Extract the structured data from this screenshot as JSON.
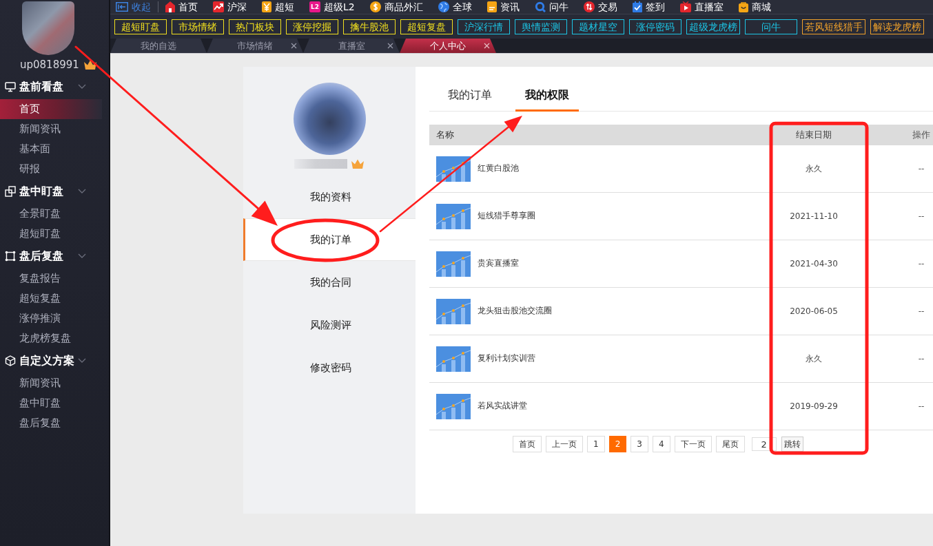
{
  "sidebar": {
    "user": {
      "name": "up0818991"
    },
    "sections": [
      {
        "title": "盘前看盘",
        "expanded": true,
        "items": [
          {
            "label": "首页",
            "selected": true
          },
          {
            "label": "新闻资讯",
            "selected": false
          },
          {
            "label": "基本面",
            "selected": false
          },
          {
            "label": "研报",
            "selected": false
          }
        ]
      },
      {
        "title": "盘中盯盘",
        "expanded": true,
        "items": [
          {
            "label": "全景盯盘",
            "selected": false
          },
          {
            "label": "超短盯盘",
            "selected": false
          }
        ]
      },
      {
        "title": "盘后复盘",
        "expanded": true,
        "items": [
          {
            "label": "复盘报告",
            "selected": false
          },
          {
            "label": "超短复盘",
            "selected": false
          },
          {
            "label": "涨停推演",
            "selected": false
          },
          {
            "label": "龙虎榜复盘",
            "selected": false
          }
        ]
      },
      {
        "title": "自定义方案",
        "expanded": true,
        "items": [
          {
            "label": "新闻资讯",
            "selected": false
          },
          {
            "label": "盘中盯盘",
            "selected": false
          },
          {
            "label": "盘后复盘",
            "selected": false
          }
        ]
      }
    ]
  },
  "toolbar": {
    "collapse": "收起",
    "items": [
      {
        "label": "首页"
      },
      {
        "label": "沪深"
      },
      {
        "label": "超短"
      },
      {
        "label": "超级L2",
        "icon_text": "L2"
      },
      {
        "label": "商品外汇"
      },
      {
        "label": "全球"
      },
      {
        "label": "资讯"
      },
      {
        "label": "问牛"
      },
      {
        "label": "交易"
      },
      {
        "label": "签到"
      },
      {
        "label": "直播室"
      },
      {
        "label": "商城"
      }
    ]
  },
  "quick_links": [
    {
      "label": "超短盯盘",
      "color": "#f2e01e"
    },
    {
      "label": "市场情绪",
      "color": "#f2e01e"
    },
    {
      "label": "热门板块",
      "color": "#f2e01e"
    },
    {
      "label": "涨停挖掘",
      "color": "#f2e01e"
    },
    {
      "label": "擒牛股池",
      "color": "#f2e01e"
    },
    {
      "label": "超短复盘",
      "color": "#f2e01e"
    },
    {
      "label": "沪深行情",
      "color": "#1cc6e6"
    },
    {
      "label": "舆情监测",
      "color": "#1cc6e6"
    },
    {
      "label": "题材星空",
      "color": "#1cc6e6"
    },
    {
      "label": "涨停密码",
      "color": "#1cc6e6"
    },
    {
      "label": "超级龙虎榜",
      "color": "#1cc6e6"
    },
    {
      "label": "问牛",
      "color": "#1cc6e6"
    },
    {
      "label": "若风短线猎手",
      "color": "#f0a12a"
    },
    {
      "label": "解读龙虎榜",
      "color": "#f0a12a"
    }
  ],
  "tabs": [
    {
      "label": "我的自选",
      "selected": false,
      "closable": false
    },
    {
      "label": "市场情绪",
      "selected": false,
      "closable": true
    },
    {
      "label": "直播室",
      "selected": false,
      "closable": true
    },
    {
      "label": "个人中心",
      "selected": true,
      "closable": true
    }
  ],
  "profile": {
    "menu": [
      {
        "label": "我的资料",
        "selected": false
      },
      {
        "label": "我的订单",
        "selected": true
      },
      {
        "label": "我的合同",
        "selected": false
      },
      {
        "label": "风险测评",
        "selected": false
      },
      {
        "label": "修改密码",
        "selected": false
      }
    ]
  },
  "content_tabs": [
    {
      "label": "我的订单",
      "selected": false
    },
    {
      "label": "我的权限",
      "selected": true
    }
  ],
  "table": {
    "columns": [
      "名称",
      "结束日期",
      "操作"
    ],
    "rows": [
      {
        "name": "红黄白股池",
        "end_date": "永久",
        "action": "--"
      },
      {
        "name": "短线猎手尊享圈",
        "end_date": "2021-11-10",
        "action": "--"
      },
      {
        "name": "贵宾直播室",
        "end_date": "2021-04-30",
        "action": "--"
      },
      {
        "name": "龙头狙击股池交流圈",
        "end_date": "2020-06-05",
        "action": "--"
      },
      {
        "name": "复利计划实训营",
        "end_date": "永久",
        "action": "--"
      },
      {
        "name": "若风实战讲堂",
        "end_date": "2019-09-29",
        "action": "--"
      }
    ]
  },
  "pagination": {
    "buttons": [
      {
        "label": "首页",
        "selected": false
      },
      {
        "label": "上一页",
        "selected": false
      },
      {
        "label": "1",
        "selected": false
      },
      {
        "label": "2",
        "selected": true
      },
      {
        "label": "3",
        "selected": false
      },
      {
        "label": "4",
        "selected": false
      },
      {
        "label": "下一页",
        "selected": false
      },
      {
        "label": "尾页",
        "selected": false
      }
    ],
    "jump_value": "2",
    "jump_button": "跳转"
  },
  "annotations": [
    {
      "kind": "arrow"
    },
    {
      "kind": "ellipse"
    },
    {
      "kind": "arrow"
    },
    {
      "kind": "frame"
    }
  ]
}
